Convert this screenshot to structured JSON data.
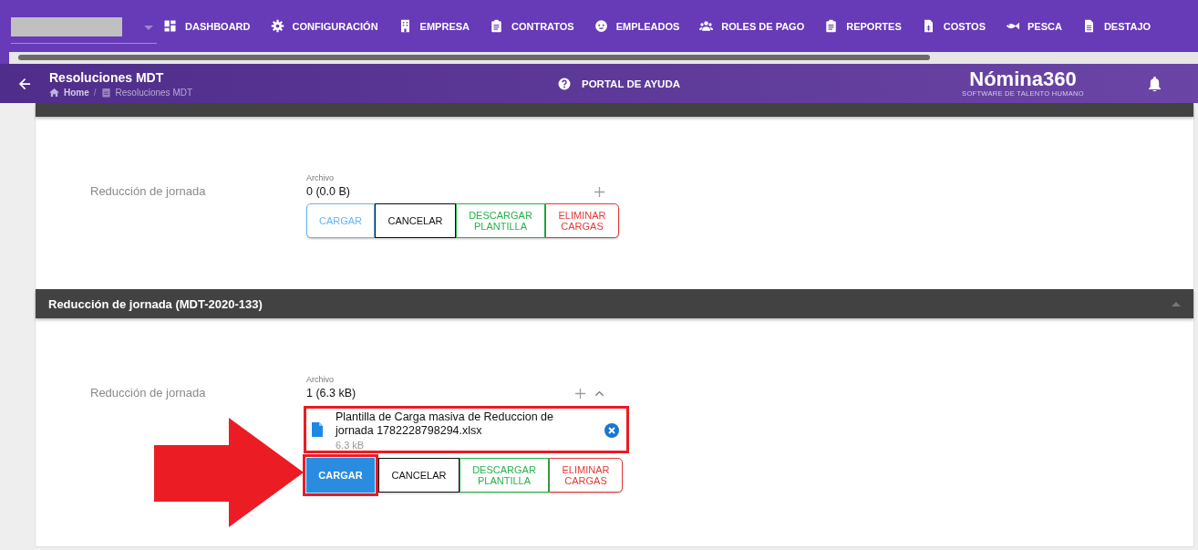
{
  "nav": {
    "items": [
      {
        "label": "DASHBOARD"
      },
      {
        "label": "CONFIGURACIÓN"
      },
      {
        "label": "EMPRESA"
      },
      {
        "label": "CONTRATOS"
      },
      {
        "label": "EMPLEADOS"
      },
      {
        "label": "ROLES DE PAGO"
      },
      {
        "label": "REPORTES"
      },
      {
        "label": "COSTOS"
      },
      {
        "label": "PESCA"
      },
      {
        "label": "DESTAJO"
      }
    ]
  },
  "header": {
    "title": "Resoluciones MDT",
    "breadcrumb": [
      "Home",
      "Resoluciones MDT"
    ],
    "separator": "/",
    "help": "PORTAL DE AYUDA",
    "logo": "Nómina360",
    "tagline": "SOFTWARE DE TALENTO HUMANO"
  },
  "panels": [
    {
      "field": {
        "label": "Reducción de jornada",
        "file_label": "Archivo",
        "count": "0 (0.0 B)"
      },
      "buttons": [
        {
          "kind": "cargar",
          "label": "CARGAR",
          "active": false
        },
        {
          "kind": "cancelar",
          "label": "CANCELAR",
          "active": false
        },
        {
          "kind": "descargar",
          "label": "DESCARGAR PLANTILLA",
          "active": false
        },
        {
          "kind": "eliminar",
          "label": "ELIMINAR CARGAS",
          "active": false
        }
      ]
    },
    {
      "title": "Reducción de jornada (MDT-2020-133)",
      "expanded": true,
      "field": {
        "label": "Reducción de jornada",
        "file_label": "Archivo",
        "count": "1 (6.3 kB)",
        "files_expanded": true,
        "files": [
          {
            "name": "Plantilla de Carga masiva de Reduccion de jornada 1782228798294.xlsx",
            "size": "6.3 kB",
            "highlighted": true
          }
        ]
      },
      "buttons": [
        {
          "kind": "cargar",
          "label": "CARGAR",
          "active": true,
          "highlighted": true
        },
        {
          "kind": "cancelar",
          "label": "CANCELAR",
          "active": false
        },
        {
          "kind": "descargar",
          "label": "DESCARGAR PLANTILLA",
          "active": false
        },
        {
          "kind": "eliminar",
          "label": "ELIMINAR CARGAS",
          "active": false
        }
      ]
    }
  ]
}
